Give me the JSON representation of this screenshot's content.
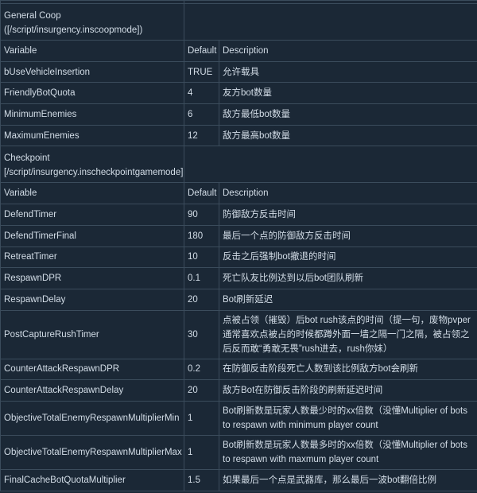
{
  "sections": [
    {
      "title_line1": "General Coop",
      "title_line2": "([/script/insurgency.inscoopmode])",
      "header": {
        "variable": "Variable",
        "default": "Default",
        "description": "Description"
      },
      "rows": [
        {
          "variable": "bUseVehicleInsertion",
          "default": "TRUE",
          "description": "允许载具"
        },
        {
          "variable": "FriendlyBotQuota",
          "default": "4",
          "description": "友方bot数量"
        },
        {
          "variable": "MinimumEnemies",
          "default": "6",
          "description": "敌方最低bot数量"
        },
        {
          "variable": "MaximumEnemies",
          "default": "12",
          "description": "敌方最高bot数量"
        }
      ]
    },
    {
      "title_line1": "Checkpoint",
      "title_line2": "[/script/insurgency.inscheckpointgamemode]",
      "header": {
        "variable": "Variable",
        "default": "Default",
        "description": "Description"
      },
      "rows": [
        {
          "variable": "DefendTimer",
          "default": "90",
          "description": "防御敌方反击时间"
        },
        {
          "variable": "DefendTimerFinal",
          "default": "180",
          "description": "最后一个点的防御敌方反击时间"
        },
        {
          "variable": "RetreatTimer",
          "default": "10",
          "description": "反击之后强制bot撤退的时间"
        },
        {
          "variable": "RespawnDPR",
          "default": "0.1",
          "description": "死亡队友比例达到以后bot团队刷新"
        },
        {
          "variable": "RespawnDelay",
          "default": "20",
          "description": "Bot刷新延迟"
        },
        {
          "variable": "PostCaptureRushTimer",
          "default": "30",
          "description": "点被占领（摧毁）后bot rush该点的时间（提一句，废物pvper通常喜欢点被占的时候都蹲外面一墙之隔一门之隔，被占领之后反而敢“勇敢无畏”rush进去，rush你妹）"
        },
        {
          "variable": "CounterAttackRespawnDPR",
          "default": "0.2",
          "description": "在防御反击阶段死亡人数到该比例敌方bot会刷新"
        },
        {
          "variable": "CounterAttackRespawnDelay",
          "default": "20",
          "description": "敌方Bot在防御反击阶段的刷新延迟时间"
        },
        {
          "variable": "ObjectiveTotalEnemyRespawnMultiplierMin",
          "default": "1",
          "description": "Bot刷新数是玩家人数最少时的xx倍数（没懂Multiplier of bots to respawn with minimum player count"
        },
        {
          "variable": "ObjectiveTotalEnemyRespawnMultiplierMax",
          "default": "1",
          "description": "Bot刷新数是玩家人数最多时的xx倍数（没懂Multiplier of bots to respawn with maxmum player count"
        },
        {
          "variable": "FinalCacheBotQuotaMultiplier",
          "default": "1.5",
          "description": "如果最后一个点是武器库，那么最后一波bot翻倍比例"
        }
      ]
    }
  ]
}
